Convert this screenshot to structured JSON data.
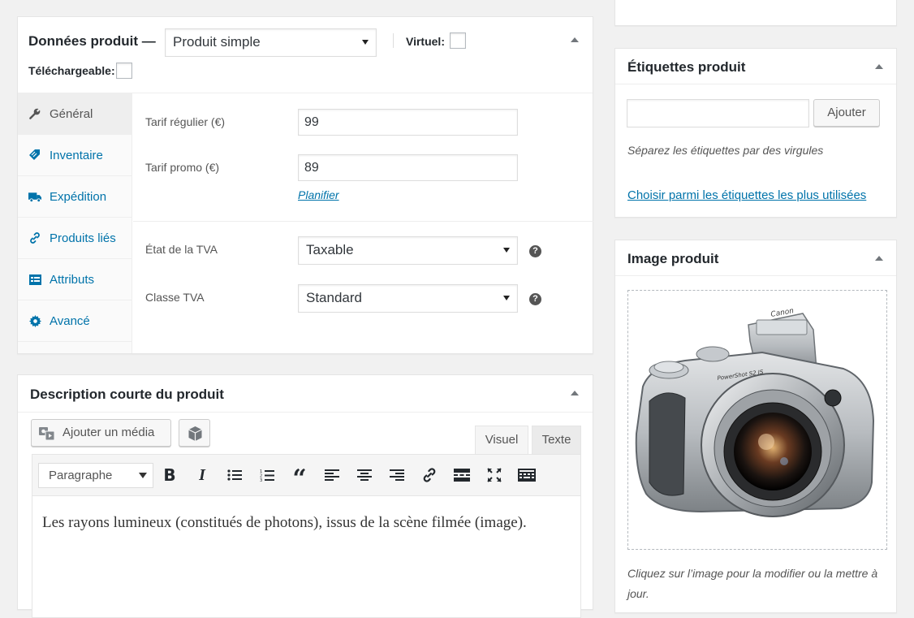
{
  "product_data": {
    "title": "Données produit —",
    "type_select": "Produit simple",
    "virtual_label": "Virtuel:",
    "downloadable_label": "Téléchargeable:",
    "tabs": [
      {
        "label": "Général",
        "icon": "wrench-icon"
      },
      {
        "label": "Inventaire",
        "icon": "tag-icon"
      },
      {
        "label": "Expédition",
        "icon": "truck-icon"
      },
      {
        "label": "Produits liés",
        "icon": "link-icon"
      },
      {
        "label": "Attributs",
        "icon": "list-icon"
      },
      {
        "label": "Avancé",
        "icon": "gear-icon"
      }
    ],
    "general": {
      "regular_price_label": "Tarif régulier (€)",
      "regular_price": "99",
      "sale_price_label": "Tarif promo (€)",
      "sale_price": "89",
      "schedule_link": "Planifier",
      "tax_status_label": "État de la TVA",
      "tax_status": "Taxable",
      "tax_class_label": "Classe TVA",
      "tax_class": "Standard",
      "help": "?"
    }
  },
  "short_description": {
    "title": "Description courte du produit",
    "add_media": "Ajouter un média",
    "tab_visual": "Visuel",
    "tab_text": "Texte",
    "format_select": "Paragraphe",
    "content": "Les rayons lumineux (constitués de photons), issus de la scène filmée (image)."
  },
  "tags": {
    "title": "Étiquettes produit",
    "input_value": "",
    "add_button": "Ajouter",
    "hint": "Séparez les étiquettes par des virgules",
    "most_used_link": "Choisir parmi les étiquettes les plus utilisées"
  },
  "image": {
    "title": "Image produit",
    "hint": "Cliquez sur l’image pour la modifier ou la mettre à jour.",
    "camera_brand": "Canon",
    "camera_model": "PowerShot S2 IS"
  },
  "colors": {
    "link": "#0073aa",
    "text": "#23282d",
    "muted": "#555555",
    "background": "#f1f1f1"
  }
}
